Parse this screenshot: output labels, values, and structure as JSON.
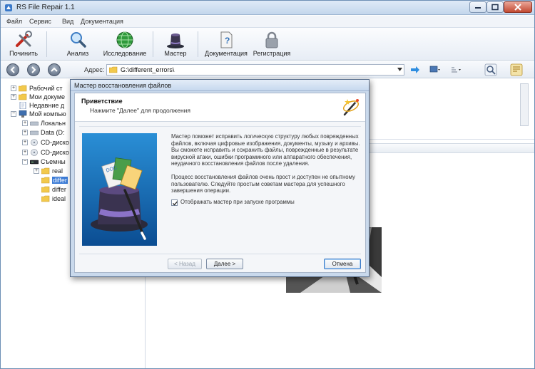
{
  "window": {
    "title": "RS File Repair 1.1"
  },
  "menu": [
    "Файл",
    "Сервис",
    "Вид",
    "Документация"
  ],
  "toolbar": {
    "items": [
      {
        "label": "Починить",
        "icon": "repair-icon"
      },
      {
        "label": "Анализ",
        "icon": "magnifier-icon"
      },
      {
        "label": "Исследование",
        "icon": "globe-icon"
      },
      {
        "label": "Мастер",
        "icon": "wizard-hat-icon"
      },
      {
        "label": "Документация",
        "icon": "help-document-icon"
      },
      {
        "label": "Регистрация",
        "icon": "lock-icon"
      }
    ]
  },
  "address": {
    "label": "Адрес:",
    "value": "G:\\different_errors\\"
  },
  "tree": {
    "items": [
      {
        "label": "Рабочий ст",
        "icon": "folder"
      },
      {
        "label": "Мои докуме",
        "icon": "folder"
      },
      {
        "label": "Недавние д",
        "icon": "recent-docs"
      },
      {
        "label": "Мой компью",
        "icon": "computer"
      },
      {
        "label": "Локальн",
        "icon": "disk"
      },
      {
        "label": "Data (D:",
        "icon": "disk"
      },
      {
        "label": "CD-диско",
        "icon": "cd"
      },
      {
        "label": "CD-диско",
        "icon": "cd"
      },
      {
        "label": "Съемны",
        "icon": "removable"
      },
      {
        "label": "real",
        "icon": "folder"
      },
      {
        "label": "differ",
        "icon": "folder"
      },
      {
        "label": "differ",
        "icon": "folder"
      },
      {
        "label": "ideal",
        "icon": "folder"
      }
    ]
  },
  "dialog": {
    "title": "Мастер восстановления файлов",
    "heading": "Приветствие",
    "subheading": "Нажмите \"Далее\" для продолжения",
    "paragraph1": "Мастер поможет исправить логическую структуру любых поврежденных файлов, включая цифровые изображения, документы, музыку и архивы. Вы сможете исправить и сохранить файлы, поврежденные в результате вирусной атаки, ошибки программного или аппаратного обеспечения, неудачного восстановления файлов после удаления.",
    "paragraph2": "Процесс восстановления файлов очень прост и доступен не опытному пользователю. Следуйте простым советам мастера для успешного завершения операции.",
    "checkbox_label": "Отображать мастер при запуске программы",
    "checkbox_checked": true,
    "btn_back": "< Назад",
    "btn_next": "Далее >",
    "btn_cancel": "Отмена"
  },
  "colors": {
    "accent": "#3b7bd6",
    "titlebar": "#c3d6ec",
    "dialog_frame": "#c9d9ec"
  }
}
